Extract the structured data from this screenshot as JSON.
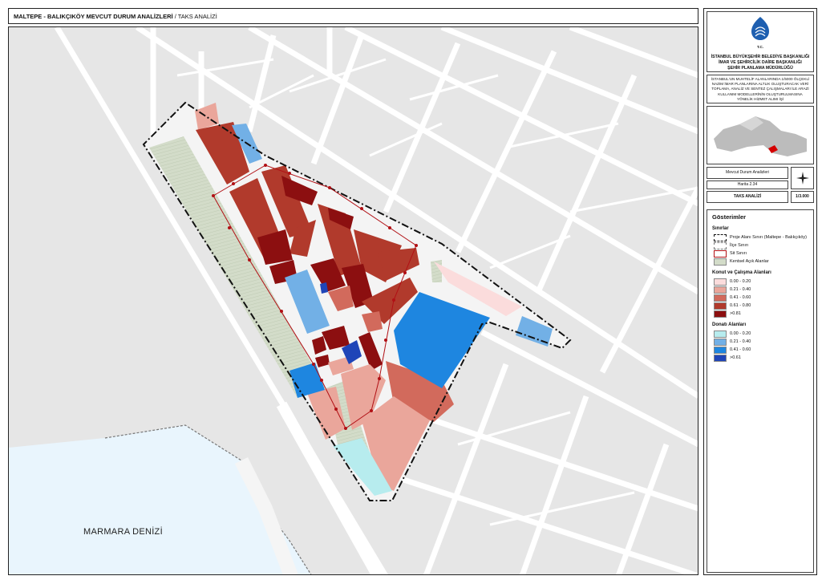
{
  "header": {
    "title": "MALTEPE - BALIKÇIKÖY MEVCUT DURUM ANALİZLERİ",
    "subtitle": "/ TAKS ANALİZİ"
  },
  "map": {
    "sea_label": "MARMARA DENİZİ"
  },
  "sidebar": {
    "logo_text": "T.C.",
    "org_line1": "İSTANBUL BÜYÜKŞEHİR BELEDİYE BAŞKANLIĞI",
    "org_line2": "İMAR VE ŞEHİRCİLİK DAİRE BAŞKANLIĞI",
    "org_line3": "ŞEHİR PLANLAMA MÜDÜRLÜĞÜ",
    "description": "İSTANBUL'UN MUHTELİF ALANLARINDA 1/5000 ÖLÇEKLİ NAZIM İMAR PLANLARINA ALTLIK OLUŞTURACAK VERİ TOPLAMA, ANALİZ VE SENTEZ ÇALIŞMALARI İLE ARAZİ KULLANIM MODELLERİNİN OLUŞTURULMASINA YÖNELİK HİZMET ALIMI İŞİ",
    "sheet": {
      "category": "Mevcut Durum Analizleri",
      "map_no": "Harita 2.34",
      "name": "TAKS ANALİZİ",
      "scale": "1/3.000"
    }
  },
  "legend": {
    "title": "Gösterimler",
    "boundaries_title": "Sınırlar",
    "boundaries": [
      {
        "label": "Proje Alanı Sınırı (Maltepe - Balıkçıköy)",
        "style": "project"
      },
      {
        "label": "İlçe Sınırı",
        "style": "district"
      },
      {
        "label": "Sit Sınırı",
        "style": "sit"
      },
      {
        "label": "Kentsel Açık Alanlar",
        "style": "open"
      }
    ],
    "residential_title": "Konut ve Çalışma Alanları",
    "residential": [
      {
        "label": "0.00 - 0.20",
        "color": "#fbdcdc"
      },
      {
        "label": "0.21 - 0.40",
        "color": "#eaa69b"
      },
      {
        "label": "0.41 - 0.60",
        "color": "#d26a5c"
      },
      {
        "label": "0.61 - 0.80",
        "color": "#b13a2c"
      },
      {
        "label": ">0.81",
        "color": "#8c0f10"
      }
    ],
    "facility_title": "Donatı Alanları",
    "facility": [
      {
        "label": "0.00 - 0.20",
        "color": "#b7ecee"
      },
      {
        "label": "0.21 - 0.40",
        "color": "#72b0e6"
      },
      {
        "label": "0.41 - 0.60",
        "color": "#1e86e0"
      },
      {
        "label": ">0.61",
        "color": "#1f45b8"
      }
    ]
  },
  "colors": {
    "sea": "#e9f5fd",
    "land": "#e6e6e6",
    "road": "#ffffff",
    "open_area": "#d3dcc9",
    "sit_line": "#b11015"
  }
}
